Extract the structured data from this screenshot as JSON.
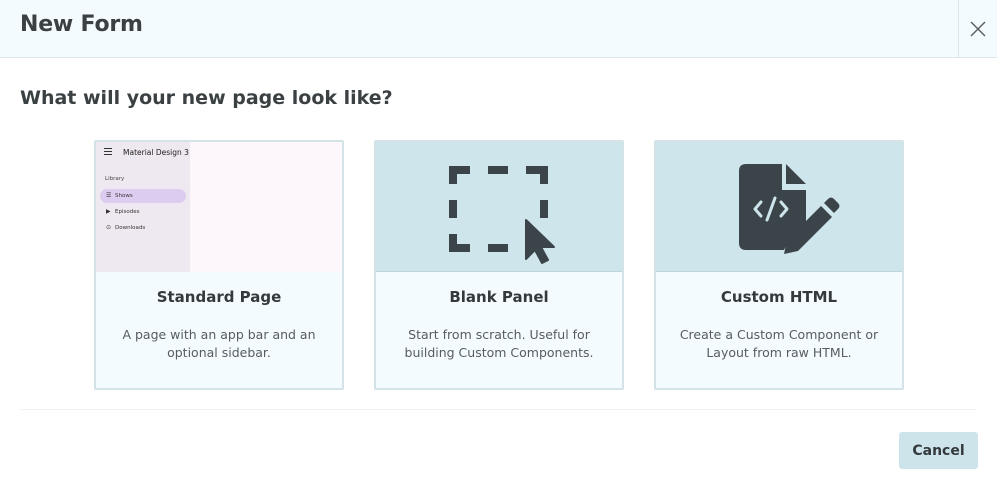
{
  "dialog": {
    "title": "New Form",
    "close_icon": "close-icon"
  },
  "question": "What will your new page look like?",
  "options": [
    {
      "title": "Standard Page",
      "description": "A page with an app bar and an optional sidebar.",
      "preview": {
        "app_title": "Material Design 3",
        "section_label": "Library",
        "nav_items": [
          {
            "icon": "list-icon",
            "label": "Shows",
            "active": true
          },
          {
            "icon": "play-icon",
            "label": "Episodes",
            "active": false
          },
          {
            "icon": "download-icon",
            "label": "Downloads",
            "active": false
          }
        ]
      }
    },
    {
      "title": "Blank Panel",
      "description": "Start from scratch. Useful for building Custom Components.",
      "icon": "dashed-selection-cursor-icon"
    },
    {
      "title": "Custom HTML",
      "description": "Create a Custom Component or Layout from raw HTML.",
      "icon": "code-file-edit-icon"
    }
  ],
  "footer": {
    "cancel_label": "Cancel"
  },
  "colors": {
    "header_bg": "#f3fbfe",
    "card_bg": "#f3fbfe",
    "thumb_bg": "#cfe5ec",
    "icon_color": "#3b4448",
    "button_bg": "#cde4ea",
    "preview_active": "#dccdf0"
  }
}
